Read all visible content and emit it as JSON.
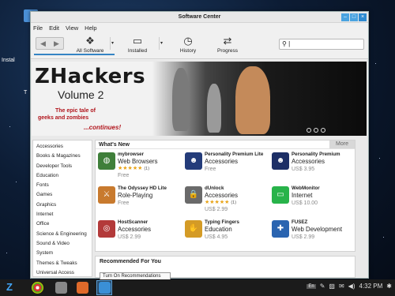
{
  "desktop": {
    "label1": "Instal",
    "label2": "T"
  },
  "window": {
    "title": "Software Center",
    "buttons": {
      "minimize": "–",
      "maximize": "□",
      "close": "×"
    },
    "menu": [
      "File",
      "Edit",
      "View",
      "Help"
    ]
  },
  "toolbar": {
    "back": "◀",
    "forward": "▶",
    "all_software": "All Software",
    "installed": "Installed",
    "history": "History",
    "progress": "Progress",
    "dropdown": "▾",
    "search_value": "|"
  },
  "banner": {
    "title": "ZHackers",
    "subtitle": "Volume 2",
    "tagline1": "The epic tale of",
    "tagline2": "geeks and zombies",
    "tagline3": "...continues!"
  },
  "sidebar": {
    "categories": [
      "Accessories",
      "Books & Magazines",
      "Developer Tools",
      "Education",
      "Fonts",
      "Games",
      "Graphics",
      "Internet",
      "Office",
      "Science & Engineering",
      "Sound & Video",
      "System",
      "Themes & Tweaks",
      "Universal Access"
    ]
  },
  "whats_new": {
    "title": "What's New",
    "more": "More",
    "apps": [
      {
        "name": "mybrowser",
        "category": "Web Browsers",
        "stars": "★★★★★",
        "rating_count": "(1)",
        "price": "Free",
        "icon": "globe-icon",
        "color": "#3f7f3a"
      },
      {
        "name": "Personality Premium Lite",
        "category": "Accessories",
        "stars": "",
        "rating_count": "",
        "price": "Free",
        "icon": "masks-icon",
        "color": "#243c7a"
      },
      {
        "name": "Personality Premium",
        "category": "Accessories",
        "stars": "",
        "rating_count": "",
        "price": "US$ 3.95",
        "icon": "masks-icon",
        "color": "#1d2f66"
      },
      {
        "name": "The Odyssey HD Lite",
        "category": "Role-Playing",
        "stars": "",
        "rating_count": "",
        "price": "Free",
        "icon": "odyssey-icon",
        "color": "#c87a2e"
      },
      {
        "name": "dUnlock",
        "category": "Accessories",
        "stars": "★★★★★",
        "rating_count": "(1)",
        "price": "US$ 2.99",
        "icon": "lock-monitor-icon",
        "color": "#6a6a6a"
      },
      {
        "name": "WebMonitor",
        "category": "Internet",
        "stars": "",
        "rating_count": "",
        "price": "US$ 10.00",
        "icon": "monitor-icon",
        "color": "#28b34a"
      },
      {
        "name": "HostScanner",
        "category": "Accessories",
        "stars": "",
        "rating_count": "",
        "price": "US$ 2.99",
        "icon": "scanner-icon",
        "color": "#b33a3a"
      },
      {
        "name": "Typing Fingers",
        "category": "Education",
        "stars": "",
        "rating_count": "",
        "price": "US$ 4.95",
        "icon": "typing-icon",
        "color": "#d49b26"
      },
      {
        "name": "FUSEZ",
        "category": "Web Development",
        "stars": "",
        "rating_count": "",
        "price": "US$ 2.99",
        "icon": "wrench-icon",
        "color": "#2a64b0"
      }
    ]
  },
  "recommended": {
    "title": "Recommended For You",
    "button": "Turn On Recommendations"
  },
  "taskbar": {
    "logo": "Z",
    "lang": "En",
    "clock": "4:32 PM",
    "apps": [
      {
        "name": "chrome-icon",
        "color": "#e0a82e"
      },
      {
        "name": "files-icon",
        "color": "#888888"
      },
      {
        "name": "office-icon",
        "color": "#e06a2a"
      },
      {
        "name": "software-center-icon",
        "color": "#3a8fd6"
      }
    ]
  }
}
